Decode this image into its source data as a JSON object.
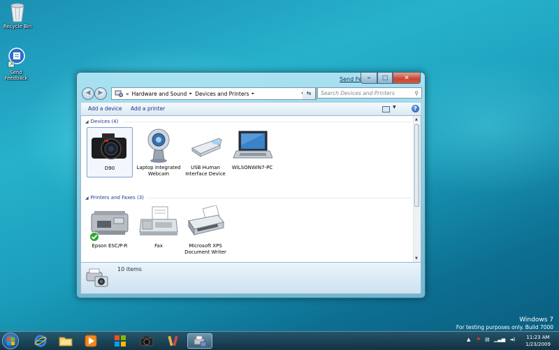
{
  "desktop": {
    "recycle_bin_label": "Recycle Bin",
    "send_feedback_label": "Send Feedback"
  },
  "window": {
    "send_feedback_link": "Send Feedback",
    "caption": {
      "minimize": "–",
      "maximize": "□",
      "close": "✕"
    },
    "address": {
      "prefix": "«",
      "crumbs": [
        "Hardware and Sound",
        "Devices and Printers"
      ],
      "separator": "►"
    },
    "search_placeholder": "Search Devices and Printers",
    "commands": {
      "add_device": "Add a device",
      "add_printer": "Add a printer"
    },
    "groups": {
      "devices": {
        "header": "Devices (4)",
        "items": [
          {
            "label": "D90",
            "icon": "camera-icon"
          },
          {
            "label": "Laptop Integrated Webcam",
            "icon": "webcam-icon"
          },
          {
            "label": "USB Human Interface Device",
            "icon": "usb-device-icon"
          },
          {
            "label": "WILSONWIN7-PC",
            "icon": "laptop-icon"
          }
        ]
      },
      "printers": {
        "header": "Printers and Faxes (3)",
        "items": [
          {
            "label": "Epson ESC/P-R",
            "icon": "printer-icon",
            "default": true
          },
          {
            "label": "Fax",
            "icon": "fax-icon"
          },
          {
            "label": "Microsoft XPS Document Writer",
            "icon": "xps-printer-icon"
          }
        ]
      }
    },
    "details": {
      "item_count": "10 items"
    }
  },
  "watermark": {
    "line1": "Windows 7",
    "line2": "For testing purposes only. Build 7000"
  },
  "taskbar": {
    "time": "11:23 AM",
    "date": "1/23/2009",
    "pinned": [
      "internet-explorer-icon",
      "explorer-icon",
      "media-player-icon",
      "windows-update-icon",
      "camera-app-icon",
      "paint-icon",
      "devices-printers-icon"
    ]
  },
  "colors": {
    "link": "#1e3287",
    "group_header": "#1e3a8a",
    "close_button": "#c64533"
  }
}
